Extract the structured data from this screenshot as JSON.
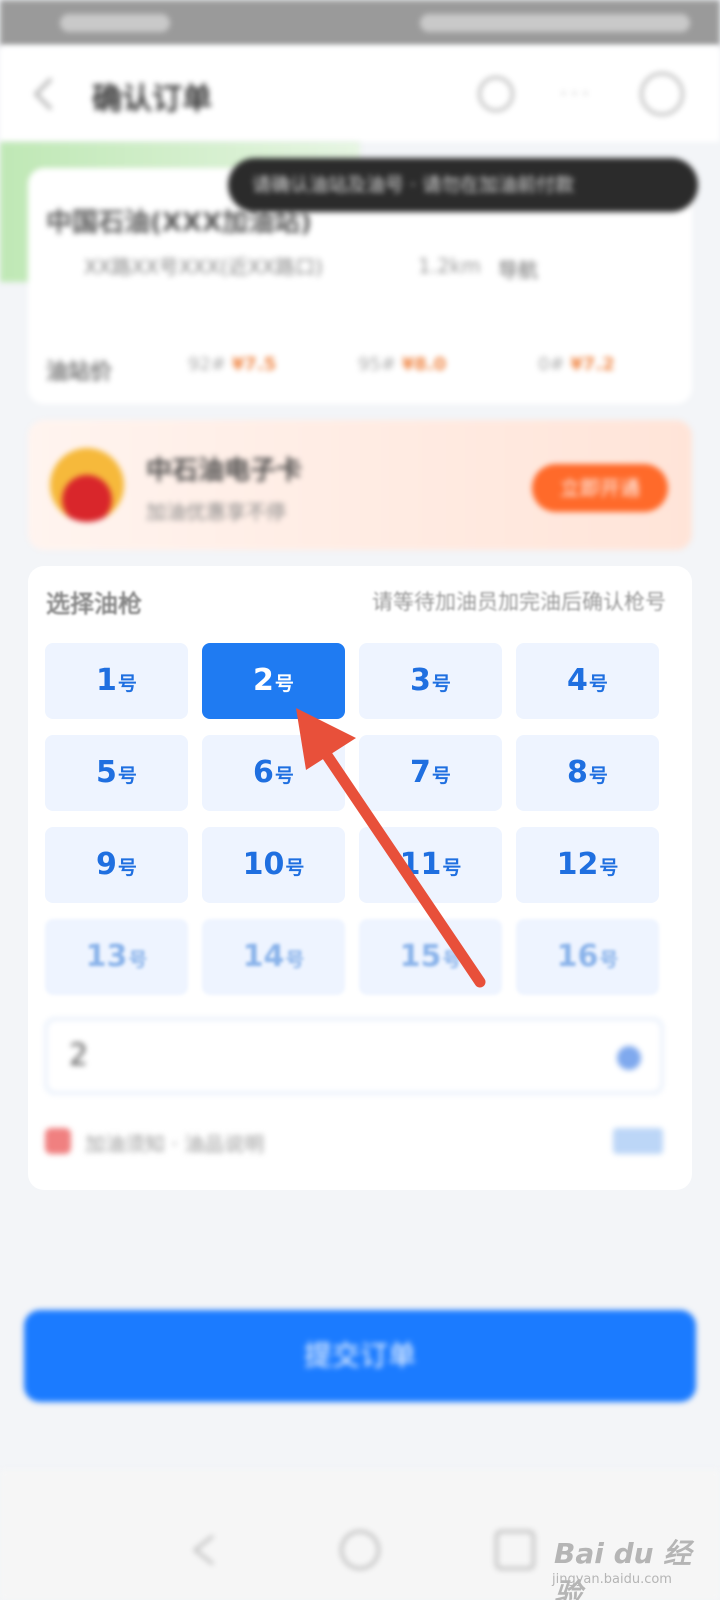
{
  "status_bar": {},
  "header": {
    "title": "确认订单",
    "more_dots": "···"
  },
  "station": {
    "name": "中国石油(XXX加油站)",
    "address": "XX路XX号XXX(近XX路口)",
    "distance": "1.2km",
    "nav_label": "导航",
    "price_label": "油站价",
    "prices": [
      {
        "grade": "92#",
        "price": "¥7.5"
      },
      {
        "grade": "95#",
        "price": "¥8.0"
      },
      {
        "grade": "0#",
        "price": "¥7.2"
      }
    ]
  },
  "toast": {
    "text": "请确认油站及油号 · 请勿在加油前付款"
  },
  "promo": {
    "title": "中石油电子卡",
    "subtitle": "加油优惠享不停",
    "button_label": "立即开通"
  },
  "pump_section": {
    "title": "选择油枪",
    "hint": "请等待加油员加完油后确认枪号",
    "pumps": [
      {
        "num": "1",
        "unit": "号",
        "state": "normal"
      },
      {
        "num": "2",
        "unit": "号",
        "state": "selected"
      },
      {
        "num": "3",
        "unit": "号",
        "state": "normal"
      },
      {
        "num": "4",
        "unit": "号",
        "state": "normal"
      },
      {
        "num": "5",
        "unit": "号",
        "state": "normal"
      },
      {
        "num": "6",
        "unit": "号",
        "state": "normal"
      },
      {
        "num": "7",
        "unit": "号",
        "state": "normal"
      },
      {
        "num": "8",
        "unit": "号",
        "state": "normal"
      },
      {
        "num": "9",
        "unit": "号",
        "state": "normal"
      },
      {
        "num": "10",
        "unit": "号",
        "state": "normal"
      },
      {
        "num": "11",
        "unit": "号",
        "state": "normal"
      },
      {
        "num": "12",
        "unit": "号",
        "state": "normal"
      },
      {
        "num": "13",
        "unit": "号",
        "state": "faded"
      },
      {
        "num": "14",
        "unit": "号",
        "state": "faded"
      },
      {
        "num": "15",
        "unit": "号",
        "state": "faded"
      },
      {
        "num": "16",
        "unit": "号",
        "state": "faded"
      }
    ],
    "gun_input_value": "2",
    "tip_text": "加油须知 · 油品说明",
    "tip_link": ""
  },
  "footer_note": "",
  "submit_button": {
    "label": "提交订单"
  },
  "watermark": {
    "text": "Bai du 经验",
    "sub": "jingyan.baidu.com"
  },
  "colors": {
    "primary": "#1b7bff",
    "selected_pump": "#1f7bf2",
    "pump_bg": "#eef4ff",
    "pump_text": "#1f6fe0",
    "annotation_arrow": "#e8503a",
    "promo_button": "#ff6a2a"
  }
}
